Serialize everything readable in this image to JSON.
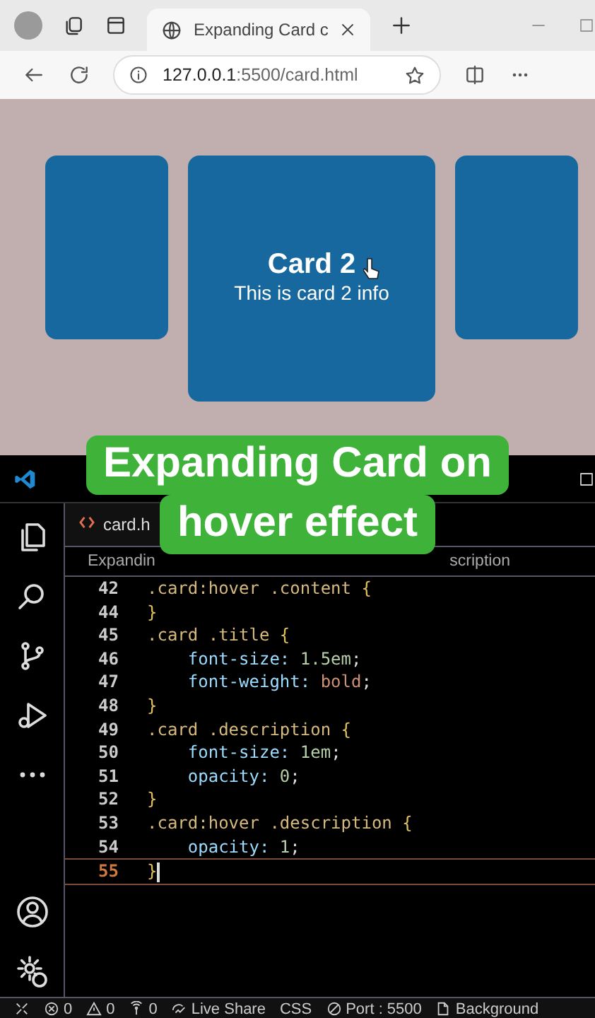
{
  "browser": {
    "tab": {
      "title": "Expanding Card c",
      "selected": true
    },
    "address": {
      "host": "127.0.0.1",
      "path": ":5500/card.html"
    }
  },
  "page": {
    "cards": [
      {
        "hovered": false
      },
      {
        "title": "Card 2",
        "info": "This is card 2 info",
        "hovered": true
      },
      {
        "hovered": false
      }
    ]
  },
  "editor": {
    "tab": {
      "label": "card.h",
      "selected": true
    },
    "breadcrumb": [
      "Expandin",
      "scription"
    ],
    "lines": [
      {
        "number": "42",
        "current": false,
        "tokens": [
          {
            "t": ".card:hover .content ",
            "kind": "selector"
          },
          {
            "t": "{",
            "kind": "brace"
          }
        ]
      },
      {
        "number": "44",
        "current": false,
        "tokens": [
          {
            "t": "}",
            "kind": "brace"
          }
        ]
      },
      {
        "number": "45",
        "current": false,
        "tokens": [
          {
            "t": ".card .title ",
            "kind": "selector"
          },
          {
            "t": "{",
            "kind": "brace"
          }
        ]
      },
      {
        "number": "46",
        "current": false,
        "tokens": [
          {
            "t": "    font-size: ",
            "kind": "prop"
          },
          {
            "t": "1.5em",
            "kind": "number"
          },
          {
            "t": ";",
            "kind": "punct"
          }
        ]
      },
      {
        "number": "47",
        "current": false,
        "tokens": [
          {
            "t": "    font-weight: ",
            "kind": "prop"
          },
          {
            "t": "bold",
            "kind": "value"
          },
          {
            "t": ";",
            "kind": "punct"
          }
        ]
      },
      {
        "number": "48",
        "current": false,
        "tokens": [
          {
            "t": "}",
            "kind": "brace"
          }
        ]
      },
      {
        "number": "49",
        "current": false,
        "tokens": [
          {
            "t": ".card .description ",
            "kind": "selector"
          },
          {
            "t": "{",
            "kind": "brace"
          }
        ]
      },
      {
        "number": "50",
        "current": false,
        "tokens": [
          {
            "t": "    font-size: ",
            "kind": "prop"
          },
          {
            "t": "1em",
            "kind": "number"
          },
          {
            "t": ";",
            "kind": "punct"
          }
        ]
      },
      {
        "number": "51",
        "current": false,
        "tokens": [
          {
            "t": "    opacity: ",
            "kind": "prop"
          },
          {
            "t": "0",
            "kind": "number"
          },
          {
            "t": ";",
            "kind": "punct"
          }
        ]
      },
      {
        "number": "52",
        "current": false,
        "tokens": [
          {
            "t": "}",
            "kind": "brace"
          }
        ]
      },
      {
        "number": "53",
        "current": false,
        "tokens": [
          {
            "t": ".card:hover .description ",
            "kind": "selector"
          },
          {
            "t": "{",
            "kind": "brace"
          }
        ]
      },
      {
        "number": "54",
        "current": false,
        "tokens": [
          {
            "t": "    opacity: ",
            "kind": "prop"
          },
          {
            "t": "1",
            "kind": "number"
          },
          {
            "t": ";",
            "kind": "punct"
          }
        ]
      },
      {
        "number": "55",
        "current": true,
        "tokens": [
          {
            "t": "}",
            "kind": "brace"
          }
        ]
      }
    ]
  },
  "status_bar": [
    {
      "kind": "remote"
    },
    {
      "kind": "errors",
      "text": "0"
    },
    {
      "kind": "warnings",
      "text": "0"
    },
    {
      "kind": "ports",
      "text": "0"
    },
    {
      "kind": "share",
      "text": "Live Share"
    },
    {
      "kind": "plain",
      "text": "CSS"
    },
    {
      "kind": "port",
      "text": "Port : 5500"
    },
    {
      "kind": "doc",
      "text": "Background"
    }
  ],
  "caption": {
    "lines": [
      "Expanding Card on",
      "hover effect"
    ]
  }
}
